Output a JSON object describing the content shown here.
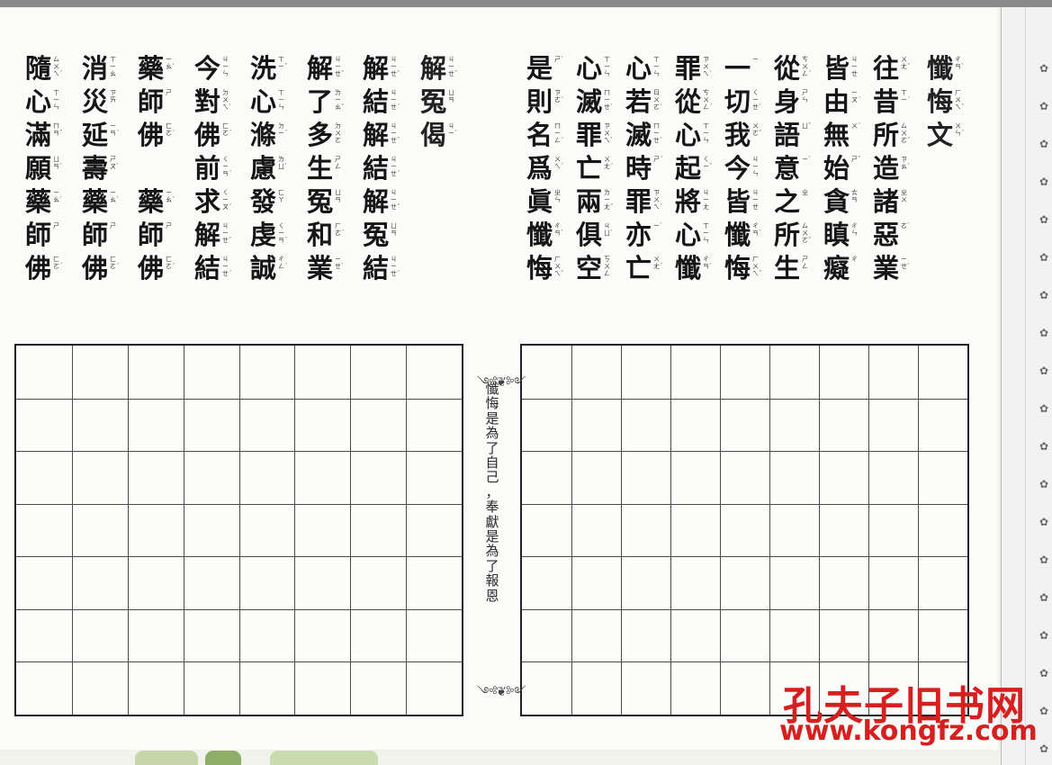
{
  "repentance": {
    "title": [
      [
        "懺",
        "ㄔㄢˋ"
      ],
      [
        "悔",
        "ㄏㄨㄟˇ"
      ],
      [
        "文",
        "ㄨㄣˊ"
      ]
    ],
    "columns": [
      [
        [
          "往",
          "ㄨㄤˇ"
        ],
        [
          "昔",
          "ㄒㄧˊ"
        ],
        [
          "所",
          "ㄙㄨㄛˇ"
        ],
        [
          "造",
          "ㄗㄠˋ"
        ],
        [
          "諸",
          "ㄓㄨ"
        ],
        [
          "惡",
          "ㄜˋ"
        ],
        [
          "業",
          "ㄧㄝˋ"
        ]
      ],
      [
        [
          "皆",
          "ㄐㄧㄝ"
        ],
        [
          "由",
          "ㄧㄡˊ"
        ],
        [
          "無",
          "ㄨˊ"
        ],
        [
          "始",
          "ㄕˇ"
        ],
        [
          "貪",
          "ㄊㄢ"
        ],
        [
          "瞋",
          "ㄔㄣ"
        ],
        [
          "癡",
          "ㄔ"
        ]
      ],
      [
        [
          "從",
          "ㄘㄨㄥˊ"
        ],
        [
          "身",
          "ㄕㄣ"
        ],
        [
          "語",
          "ㄩˇ"
        ],
        [
          "意",
          "ㄧˋ"
        ],
        [
          "之",
          "ㄓ"
        ],
        [
          "所",
          "ㄙㄨㄛˇ"
        ],
        [
          "生",
          "ㄕㄥ"
        ]
      ],
      [
        [
          "一",
          "ㄧ"
        ],
        [
          "切",
          "ㄑㄧㄝˋ"
        ],
        [
          "我",
          "ㄨㄛˇ"
        ],
        [
          "今",
          "ㄐㄧㄣ"
        ],
        [
          "皆",
          "ㄐㄧㄝ"
        ],
        [
          "懺",
          "ㄔㄢˋ"
        ],
        [
          "悔",
          "ㄏㄨㄟˇ"
        ]
      ],
      [
        [
          "罪",
          "ㄗㄨㄟˋ"
        ],
        [
          "從",
          "ㄘㄨㄥˊ"
        ],
        [
          "心",
          "ㄒㄧㄣ"
        ],
        [
          "起",
          "ㄑㄧˇ"
        ],
        [
          "將",
          "ㄐㄧㄤ"
        ],
        [
          "心",
          "ㄒㄧㄣ"
        ],
        [
          "懺",
          "ㄔㄢˋ"
        ]
      ],
      [
        [
          "心",
          "ㄒㄧㄣ"
        ],
        [
          "若",
          "ㄖㄨㄛˋ"
        ],
        [
          "滅",
          "ㄇㄧㄝˋ"
        ],
        [
          "時",
          "ㄕˊ"
        ],
        [
          "罪",
          "ㄗㄨㄟˋ"
        ],
        [
          "亦",
          "ㄧˋ"
        ],
        [
          "亡",
          "ㄨㄤˊ"
        ]
      ],
      [
        [
          "心",
          "ㄒㄧㄣ"
        ],
        [
          "滅",
          "ㄇㄧㄝˋ"
        ],
        [
          "罪",
          "ㄗㄨㄟˋ"
        ],
        [
          "亡",
          "ㄨㄤˊ"
        ],
        [
          "兩",
          "ㄌㄧㄤˇ"
        ],
        [
          "俱",
          "ㄐㄩˋ"
        ],
        [
          "空",
          "ㄎㄨㄥ"
        ]
      ],
      [
        [
          "是",
          "ㄕˋ"
        ],
        [
          "則",
          "ㄗㄜˊ"
        ],
        [
          "名",
          "ㄇㄧㄥˊ"
        ],
        [
          "爲",
          "ㄨㄟˊ"
        ],
        [
          "眞",
          "ㄓㄣ"
        ],
        [
          "懺",
          "ㄔㄢˋ"
        ],
        [
          "悔",
          "ㄏㄨㄟˇ"
        ]
      ]
    ]
  },
  "gatha": {
    "title": [
      [
        "解",
        "ㄐㄧㄝˇ"
      ],
      [
        "冤",
        "ㄩㄢ"
      ],
      [
        "偈",
        "ㄐㄧˋ"
      ]
    ],
    "columns": [
      [
        [
          "解",
          "ㄐㄧㄝˇ"
        ],
        [
          "結",
          "ㄐㄧㄝˊ"
        ],
        [
          "解",
          "ㄐㄧㄝˇ"
        ],
        [
          "結",
          "ㄐㄧㄝˊ"
        ],
        [
          "解",
          "ㄐㄧㄝˇ"
        ],
        [
          "冤",
          "ㄩㄢ"
        ],
        [
          "結",
          "ㄐㄧㄝˊ"
        ]
      ],
      [
        [
          "解",
          "ㄐㄧㄝˇ"
        ],
        [
          "了",
          "ㄌㄧㄠˇ"
        ],
        [
          "多",
          "ㄉㄨㄛ"
        ],
        [
          "生",
          "ㄕㄥ"
        ],
        [
          "冤",
          "ㄩㄢ"
        ],
        [
          "和",
          "ㄏㄜˊ"
        ],
        [
          "業",
          "ㄧㄝˋ"
        ]
      ],
      [
        [
          "洗",
          "ㄒㄧˇ"
        ],
        [
          "心",
          "ㄒㄧㄣ"
        ],
        [
          "滌",
          "ㄉㄧˊ"
        ],
        [
          "慮",
          "ㄌㄩˋ"
        ],
        [
          "發",
          "ㄈㄚ"
        ],
        [
          "虔",
          "ㄑㄧㄢˊ"
        ],
        [
          "誠",
          "ㄔㄥˊ"
        ]
      ],
      [
        [
          "今",
          "ㄐㄧㄣ"
        ],
        [
          "對",
          "ㄉㄨㄟˋ"
        ],
        [
          "佛",
          "ㄈㄛˊ"
        ],
        [
          "前",
          "ㄑㄧㄢˊ"
        ],
        [
          "求",
          "ㄑㄧㄡˊ"
        ],
        [
          "解",
          "ㄐㄧㄝˇ"
        ],
        [
          "結",
          "ㄐㄧㄝˊ"
        ]
      ],
      [
        [
          "藥",
          "ㄧㄠˋ"
        ],
        [
          "師",
          "ㄕ"
        ],
        [
          "佛",
          "ㄈㄛˊ"
        ],
        [
          "",
          ""
        ],
        [
          "藥",
          "ㄧㄠˋ"
        ],
        [
          "師",
          "ㄕ"
        ],
        [
          "佛",
          "ㄈㄛˊ"
        ]
      ],
      [
        [
          "消",
          "ㄒㄧㄠ"
        ],
        [
          "災",
          "ㄗㄞ"
        ],
        [
          "延",
          "ㄧㄢˊ"
        ],
        [
          "壽",
          "ㄕㄡˋ"
        ],
        [
          "藥",
          "ㄧㄠˋ"
        ],
        [
          "師",
          "ㄕ"
        ],
        [
          "佛",
          "ㄈㄛˊ"
        ]
      ],
      [
        [
          "隨",
          "ㄙㄨㄟˊ"
        ],
        [
          "心",
          "ㄒㄧㄣ"
        ],
        [
          "滿",
          "ㄇㄢˇ"
        ],
        [
          "願",
          "ㄩㄢˋ"
        ],
        [
          "藥",
          "ㄧㄠˋ"
        ],
        [
          "師",
          "ㄕ"
        ],
        [
          "佛",
          "ㄈㄛˊ"
        ]
      ]
    ]
  },
  "motto": [
    "懺",
    "悔",
    "是",
    "為",
    "了",
    "自",
    "己",
    "，",
    "奉",
    "獻",
    "是",
    "為",
    "了",
    "報",
    "恩"
  ],
  "watermark": {
    "name": "孔夫子旧书网",
    "url": "www.kongfz.com"
  }
}
